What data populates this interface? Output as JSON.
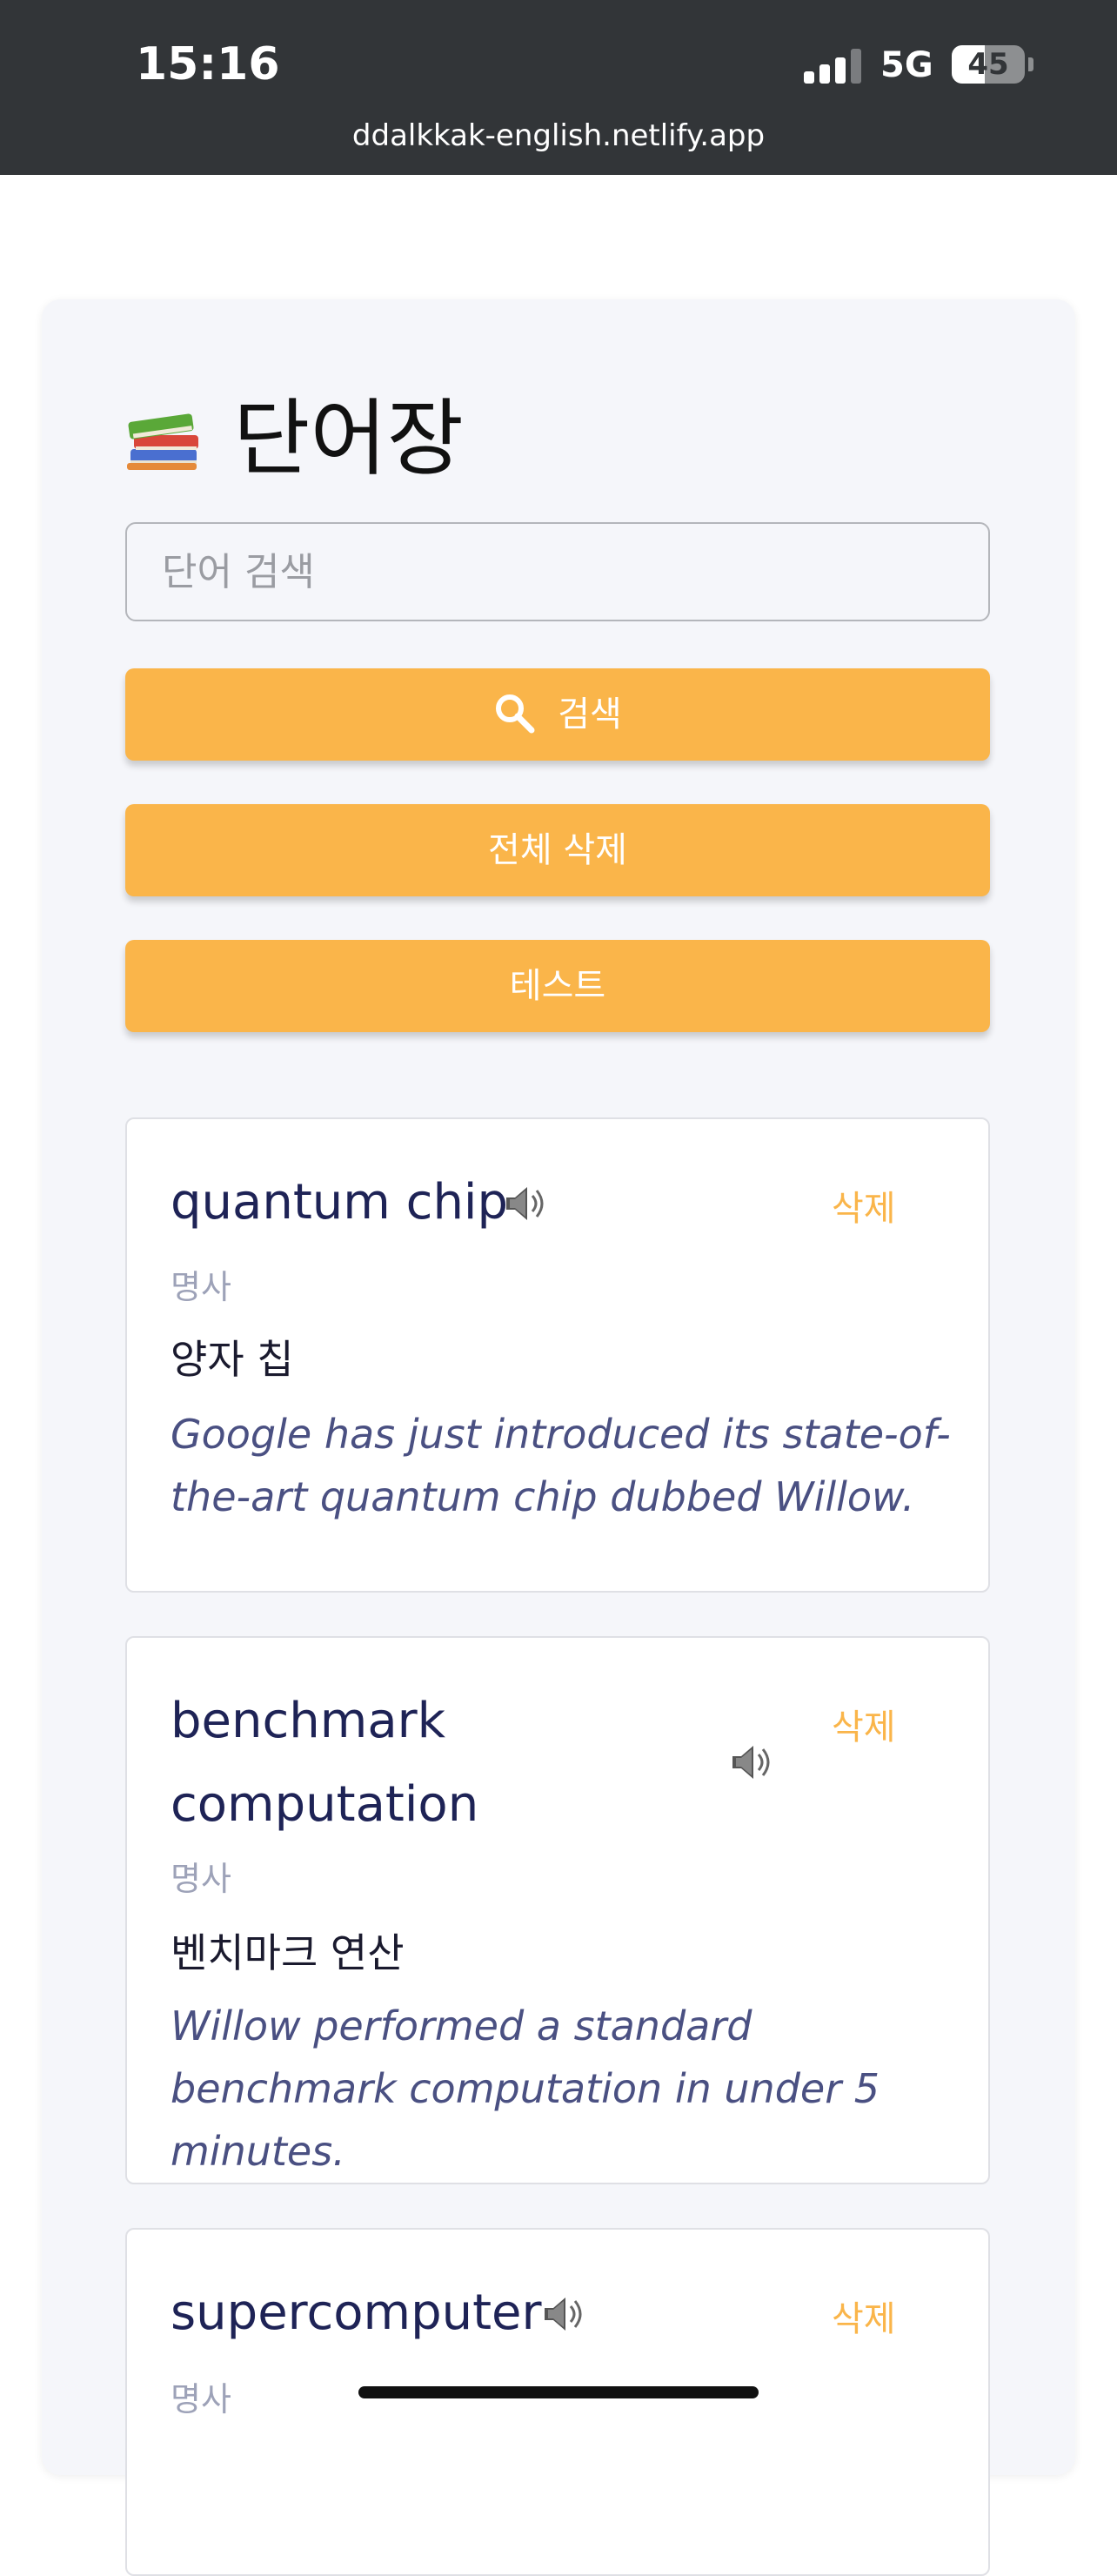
{
  "status_bar": {
    "time": "15:16",
    "network": "5G",
    "battery_percent": "45",
    "battery_level": 0.45,
    "signal_bars_filled": 3,
    "url": "ddalkkak-english.netlify.app"
  },
  "page": {
    "title": "단어장",
    "title_icon": "books-icon",
    "search": {
      "placeholder": "단어 검색",
      "value": ""
    },
    "buttons": {
      "search_label": "검색",
      "search_icon": "search-icon",
      "delete_all_label": "전체 삭제",
      "test_label": "테스트"
    },
    "accent_color": "#fab54a"
  },
  "words": [
    {
      "word": "quantum chip",
      "speaker_icon": "speaker-icon",
      "delete_label": "삭제",
      "part_of_speech": "명사",
      "meaning": "양자 칩",
      "example": "Google has just introduced its state-of-the-art quantum chip dubbed Willow."
    },
    {
      "word_line1": "benchmark",
      "word_line2": "computation",
      "speaker_icon": "speaker-icon",
      "delete_label": "삭제",
      "part_of_speech": "명사",
      "meaning": "벤치마크 연산",
      "example": "Willow performed a standard benchmark computation in under 5 minutes."
    },
    {
      "word": "supercomputer",
      "speaker_icon": "speaker-icon",
      "delete_label": "삭제",
      "part_of_speech": "명사"
    }
  ]
}
